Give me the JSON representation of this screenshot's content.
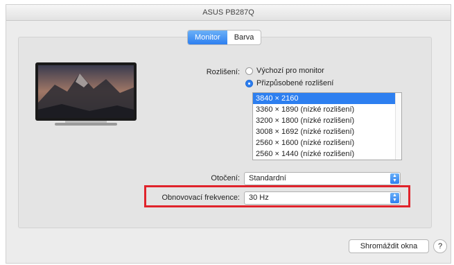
{
  "window": {
    "title": "ASUS PB287Q"
  },
  "tabs": [
    {
      "label": "Monitor",
      "active": true
    },
    {
      "label": "Barva",
      "active": false
    }
  ],
  "resolution": {
    "label": "Rozlišení:",
    "options": [
      {
        "label": "Výchozí pro monitor",
        "selected": false
      },
      {
        "label": "Přizpůsobené rozlišení",
        "selected": true
      }
    ],
    "list": [
      "3840 × 2160",
      "3360 × 1890 (nízké rozlišení)",
      "3200 × 1800 (nízké rozlišení)",
      "3008 × 1692 (nízké rozlišení)",
      "2560 × 1600 (nízké rozlišení)",
      "2560 × 1440 (nízké rozlišení)"
    ],
    "selected_item": "3840 × 2160"
  },
  "rotation": {
    "label": "Otočení:",
    "value": "Standardní"
  },
  "refresh": {
    "label": "Obnovovací frekvence:",
    "value": "30 Hz"
  },
  "buttons": {
    "gather_windows": "Shromáždit okna",
    "help": "?"
  },
  "colors": {
    "accent": "#2d7ff0",
    "highlight_border": "#e0232b"
  },
  "icons": [
    "monitor-thumbnail",
    "chevron-up-down-icon",
    "help-icon"
  ]
}
